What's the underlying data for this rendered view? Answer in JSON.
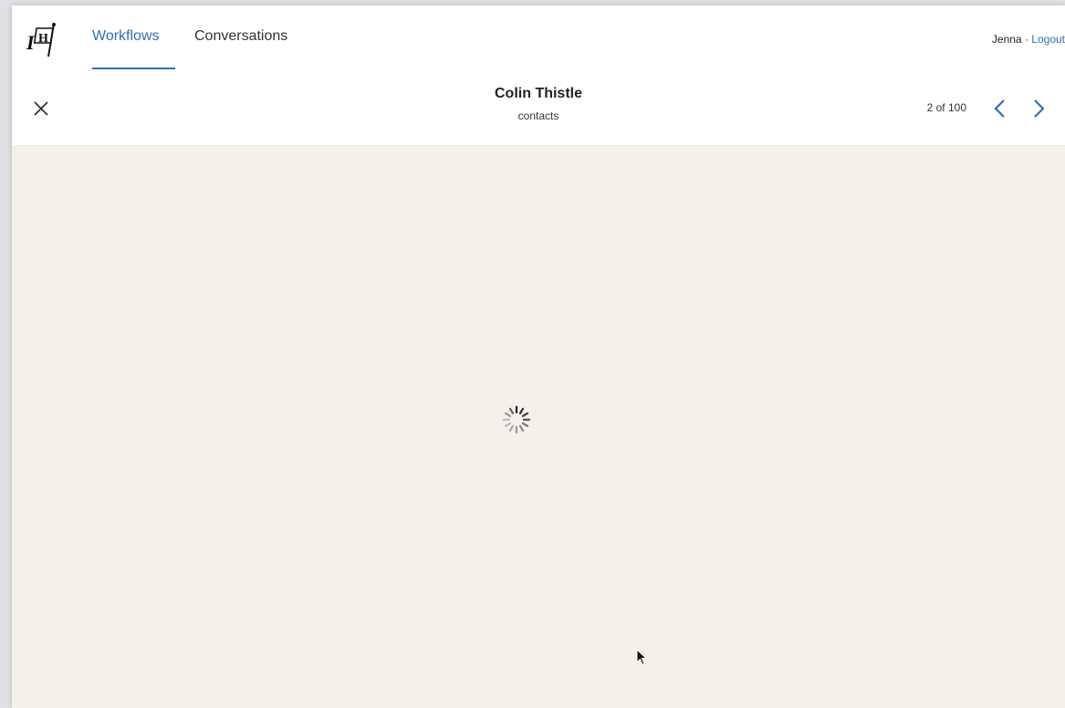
{
  "nav": {
    "tabs": [
      {
        "label": "Workflows",
        "active": true
      },
      {
        "label": "Conversations",
        "active": false
      }
    ],
    "user_name": "Jenna",
    "separator": "·",
    "logout_label": "Logout"
  },
  "record": {
    "title": "Colin Thistle",
    "subtitle": "contacts"
  },
  "pager": {
    "label": "2 of 100"
  },
  "icons": {
    "logo": "ih-flag-logo",
    "close": "close-icon",
    "prev": "chevron-left-icon",
    "next": "chevron-right-icon",
    "spinner": "loading-spinner-icon"
  },
  "colors": {
    "accent": "#2f6fb8",
    "content_bg": "#f4f0ea"
  }
}
